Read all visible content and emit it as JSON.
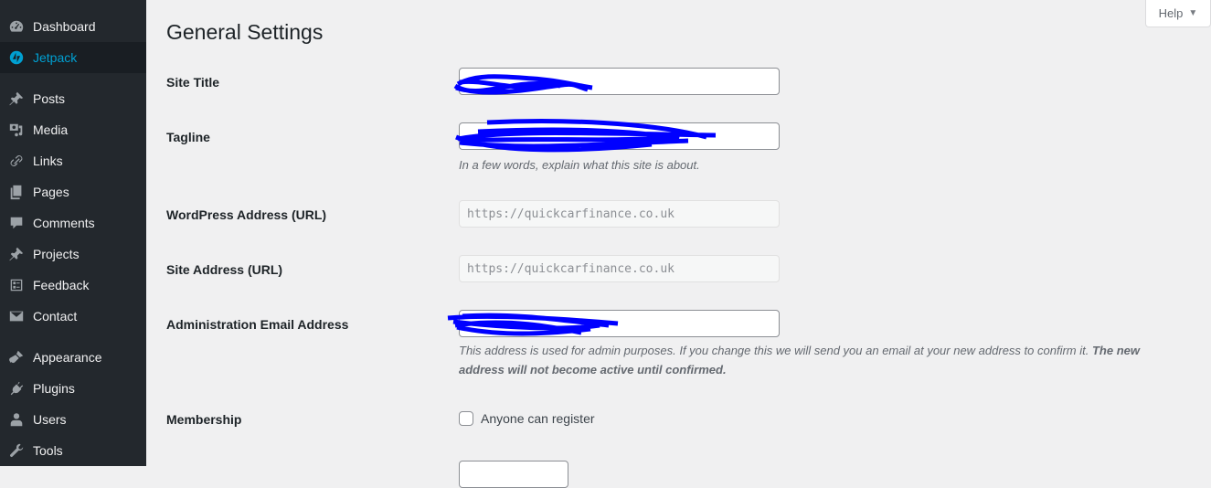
{
  "sidebar": {
    "items": [
      {
        "label": "Dashboard",
        "icon": "dashboard-icon",
        "active": false
      },
      {
        "label": "Jetpack",
        "icon": "jetpack-icon",
        "active": true
      },
      {
        "label": "Posts",
        "icon": "pushpin-icon",
        "active": false
      },
      {
        "label": "Media",
        "icon": "media-icon",
        "active": false
      },
      {
        "label": "Links",
        "icon": "link-icon",
        "active": false
      },
      {
        "label": "Pages",
        "icon": "pages-icon",
        "active": false
      },
      {
        "label": "Comments",
        "icon": "comment-icon",
        "active": false
      },
      {
        "label": "Projects",
        "icon": "pushpin-icon",
        "active": false
      },
      {
        "label": "Feedback",
        "icon": "feedback-icon",
        "active": false
      },
      {
        "label": "Contact",
        "icon": "envelope-icon",
        "active": false
      },
      {
        "label": "Appearance",
        "icon": "paintbrush-icon",
        "active": false
      },
      {
        "label": "Plugins",
        "icon": "plug-icon",
        "active": false
      },
      {
        "label": "Users",
        "icon": "user-icon",
        "active": false
      },
      {
        "label": "Tools",
        "icon": "wrench-icon",
        "active": false
      }
    ]
  },
  "header": {
    "title": "General Settings",
    "help_label": "Help",
    "help_caret": "▼"
  },
  "form": {
    "site_title": {
      "label": "Site Title",
      "value": ""
    },
    "tagline": {
      "label": "Tagline",
      "value": "",
      "description": "In a few words, explain what this site is about."
    },
    "wp_address": {
      "label": "WordPress Address (URL)",
      "value": "https://quickcarfinance.co.uk"
    },
    "site_address": {
      "label": "Site Address (URL)",
      "value": "https://quickcarfinance.co.uk"
    },
    "admin_email": {
      "label": "Administration Email Address",
      "value": "",
      "description": "This address is used for admin purposes. If you change this we will send you an email at your new address to confirm it.",
      "description_bold": "The new address will not become active until confirmed."
    },
    "membership": {
      "label": "Membership",
      "checkbox_label": "Anyone can register",
      "checked": false
    }
  },
  "colors": {
    "sidebar_bg": "#23282d",
    "active_bg": "#191e23",
    "accent": "#00a0d2",
    "redaction": "#0000ff"
  }
}
